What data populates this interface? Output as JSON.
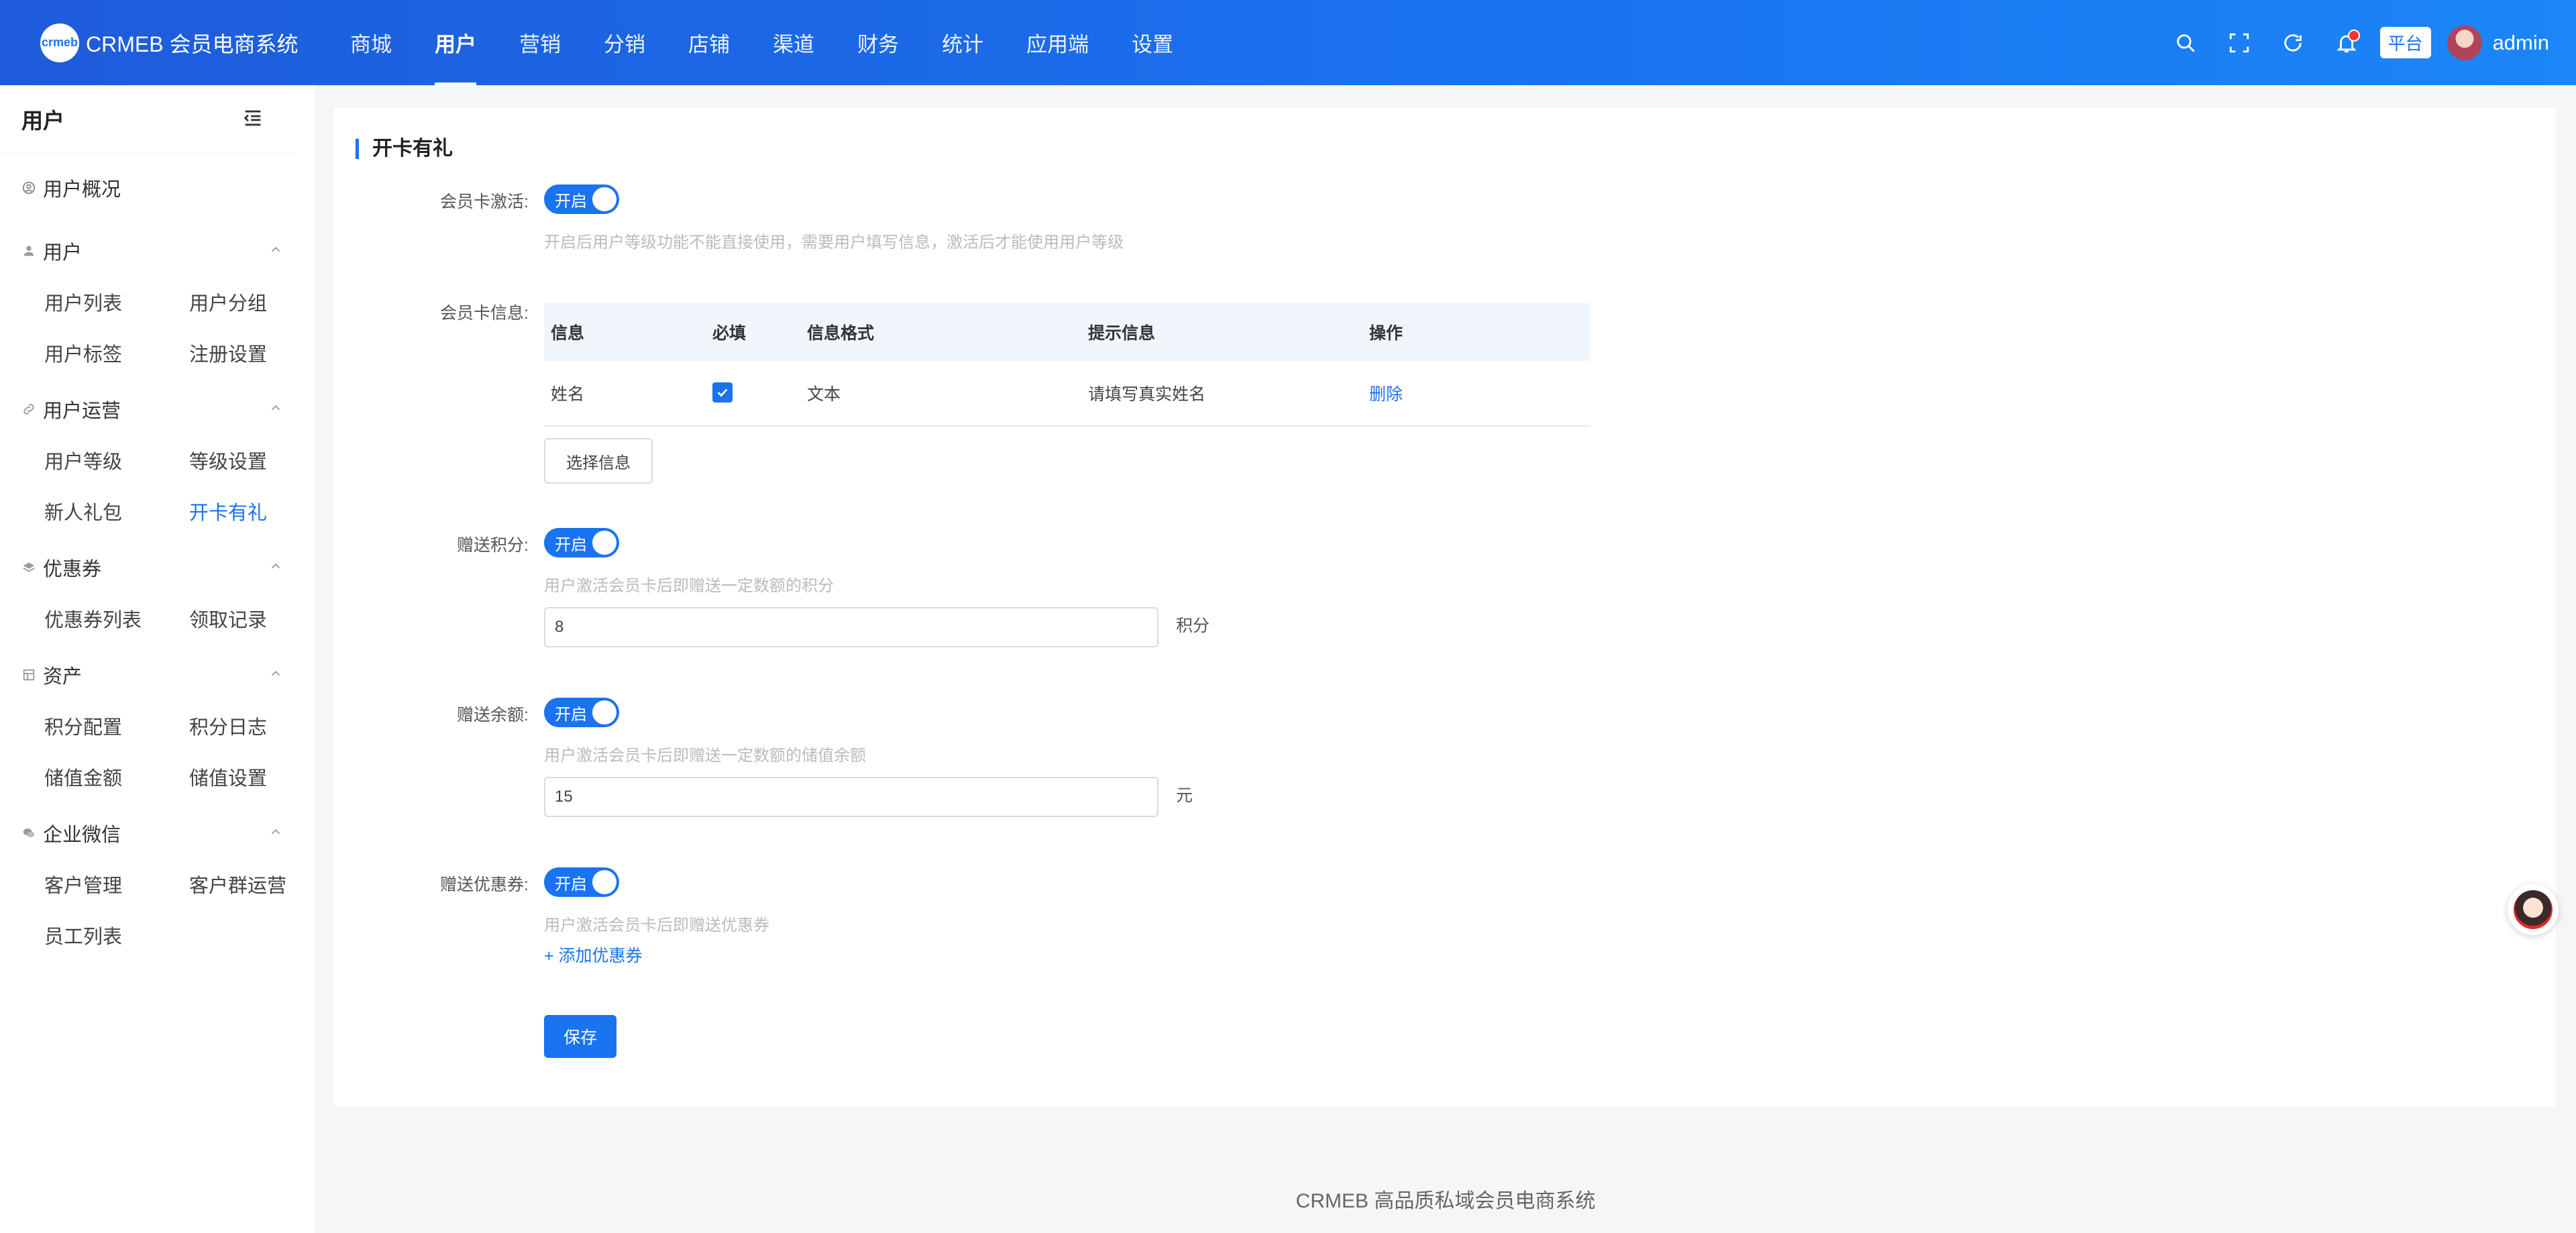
{
  "brand": {
    "logo_mark": "crmeb",
    "name": "CRMEB 会员电商系统"
  },
  "top_nav": [
    "商城",
    "用户",
    "营销",
    "分销",
    "店铺",
    "渠道",
    "财务",
    "统计",
    "应用端",
    "设置"
  ],
  "top_nav_active": "用户",
  "header": {
    "platform_label": "平台",
    "username": "admin"
  },
  "sidebar": {
    "title": "用户",
    "overview": "用户概况",
    "groups": [
      {
        "title": "用户",
        "icon": "user-icon",
        "items": [
          "用户列表",
          "用户分组",
          "用户标签",
          "注册设置"
        ]
      },
      {
        "title": "用户运营",
        "icon": "link-icon",
        "items": [
          "用户等级",
          "等级设置",
          "新人礼包",
          "开卡有礼"
        ]
      },
      {
        "title": "优惠券",
        "icon": "coupon-icon",
        "items": [
          "优惠券列表",
          "领取记录"
        ]
      },
      {
        "title": "资产",
        "icon": "asset-icon",
        "items": [
          "积分配置",
          "积分日志",
          "储值金额",
          "储值设置"
        ]
      },
      {
        "title": "企业微信",
        "icon": "wechat-icon",
        "items": [
          "客户管理",
          "客户群运营",
          "员工列表"
        ]
      }
    ],
    "active_item": "开卡有礼"
  },
  "page": {
    "section_title": "开卡有礼",
    "activation": {
      "label": "会员卡激活:",
      "switch_text": "开启",
      "hint": "开启后用户等级功能不能直接使用，需要用户填写信息，激活后才能使用用户等级"
    },
    "card_info": {
      "label": "会员卡信息:",
      "columns": [
        "信息",
        "必填",
        "信息格式",
        "提示信息",
        "操作"
      ],
      "rows": [
        {
          "info": "姓名",
          "required": true,
          "format": "文本",
          "tip": "请填写真实姓名",
          "action": "删除"
        }
      ],
      "select_button": "选择信息"
    },
    "points": {
      "label": "赠送积分:",
      "switch_text": "开启",
      "hint": "用户激活会员卡后即赠送一定数额的积分",
      "value": "8",
      "unit": "积分"
    },
    "balance": {
      "label": "赠送余额:",
      "switch_text": "开启",
      "hint": "用户激活会员卡后即赠送一定数额的储值余额",
      "value": "15",
      "unit": "元"
    },
    "coupon": {
      "label": "赠送优惠券:",
      "switch_text": "开启",
      "hint": "用户激活会员卡后即赠送优惠券",
      "add_link": "+ 添加优惠券"
    },
    "save_button": "保存"
  },
  "footer": {
    "text": "CRMEB 高品质私域会员电商系统"
  },
  "colors": {
    "primary": "#1a73f0",
    "header_start": "#1e5bdb",
    "header_end": "#1b86f7"
  }
}
